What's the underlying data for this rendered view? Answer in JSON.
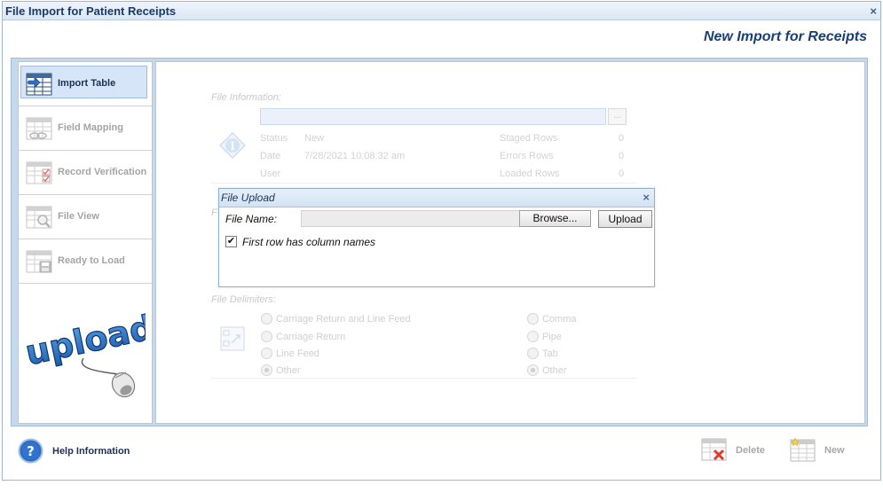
{
  "window": {
    "title": "File Import for Patient Receipts",
    "close_glyph": "×"
  },
  "page_heading": "New Import for Receipts",
  "sidebar": {
    "items": [
      {
        "label": "Import Table",
        "icon": "import-table-icon",
        "active": true
      },
      {
        "label": "Field Mapping",
        "icon": "field-mapping-icon",
        "active": false
      },
      {
        "label": "Record Verification",
        "icon": "record-verification-icon",
        "active": false
      },
      {
        "label": "File View",
        "icon": "file-view-icon",
        "active": false
      },
      {
        "label": "Ready to Load",
        "icon": "ready-to-load-icon",
        "active": false
      }
    ],
    "logo_text": "upload"
  },
  "file_info": {
    "section_title": "File Information:",
    "browse_glyph": "...",
    "status_label": "Status",
    "status_value": "New",
    "date_label": "Date",
    "date_value": "7/28/2021 10:08:32 am",
    "user_label": "User",
    "staged_rows_label": "Staged Rows",
    "staged_rows_value": "0",
    "errors_rows_label": "Errors Rows",
    "errors_rows_value": "0",
    "loaded_rows_label": "Loaded Rows",
    "loaded_rows_value": "0"
  },
  "hidden_section_initial": "F",
  "delimiters": {
    "section_title": "File Delimiters:",
    "row_options": [
      {
        "label": "Carriage Return and Line Feed",
        "selected": false
      },
      {
        "label": "Carriage Return",
        "selected": false
      },
      {
        "label": "Line Feed",
        "selected": false
      },
      {
        "label": "Other",
        "selected": true
      }
    ],
    "column_options": [
      {
        "label": "Comma",
        "selected": false
      },
      {
        "label": "Pipe",
        "selected": false
      },
      {
        "label": "Tab",
        "selected": false
      },
      {
        "label": "Other",
        "selected": true
      }
    ]
  },
  "dialog": {
    "title": "File Upload",
    "close_glyph": "×",
    "file_name_label": "File Name:",
    "file_name_value": "",
    "browse_label": "Browse...",
    "upload_label": "Upload",
    "first_row_checked": true,
    "first_row_label": "First row has column names"
  },
  "footer": {
    "help_label": "Help Information",
    "delete_label": "Delete",
    "new_label": "New"
  },
  "colors": {
    "accent": "#1b3f73",
    "panel_bg": "#c6d8ec",
    "active_nav_bg": "#d6e6f8"
  }
}
